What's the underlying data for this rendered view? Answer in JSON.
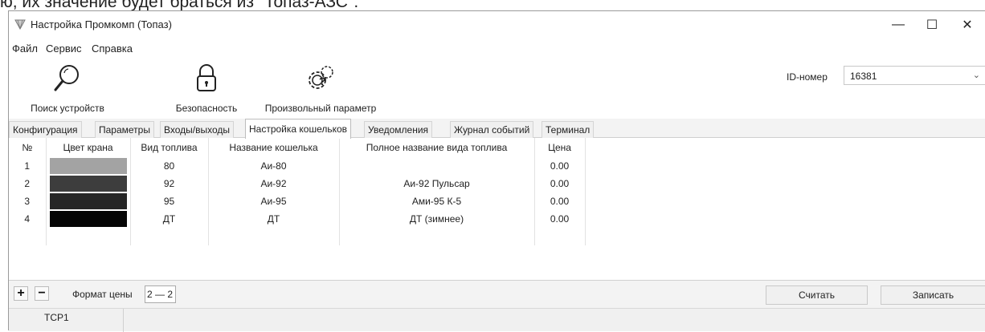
{
  "doc_line": "ю, их значение будет браться из \"Топаз-АЗС\".",
  "window": {
    "title": "Настройка Промкомп (Топаз)",
    "controls": {
      "minimize": "—",
      "maximize": "☐",
      "close": "✕"
    }
  },
  "menu": [
    "Файл",
    "Сервис",
    "Справка"
  ],
  "toolbar": {
    "tools": [
      {
        "label": "Поиск устройств",
        "icon": "magnifier-icon"
      },
      {
        "label": "Безопасность",
        "icon": "padlock-icon"
      },
      {
        "label": "Произвольный параметр",
        "icon": "gears-question-icon"
      }
    ],
    "id_label": "ID-номер",
    "id_value": "16381"
  },
  "tabs": [
    {
      "label": "Конфигурация",
      "active": false
    },
    {
      "label": "Параметры",
      "active": false
    },
    {
      "label": "Входы/выходы",
      "active": false
    },
    {
      "label": "Настройка кошельков",
      "active": true
    },
    {
      "label": "Уведомления",
      "active": false
    },
    {
      "label": "Журнал событий",
      "active": false
    },
    {
      "label": "Терминал",
      "active": false
    }
  ],
  "table": {
    "headers": [
      "№",
      "Цвет крана",
      "Вид топлива",
      "Название кошелька",
      "Полное название вида топлива",
      "Цена"
    ],
    "rows": [
      {
        "num": "1",
        "color": "#a3a3a3",
        "fuel": "80",
        "wallet": "Аи-80",
        "full_name": "",
        "price": "0.00"
      },
      {
        "num": "2",
        "color": "#3d3d3d",
        "fuel": "92",
        "wallet": "Аи-92",
        "full_name": "Аи-92 Пульсар",
        "price": "0.00"
      },
      {
        "num": "3",
        "color": "#262626",
        "fuel": "95",
        "wallet": "Аи-95",
        "full_name": "Ами-95 К-5",
        "price": "0.00"
      },
      {
        "num": "4",
        "color": "#050505",
        "fuel": "ДТ",
        "wallet": "ДТ",
        "full_name": "ДТ (зимнее)",
        "price": "0.00"
      }
    ]
  },
  "bottom": {
    "add": "+",
    "remove": "−",
    "price_format_label": "Формат цены",
    "price_format_value": "2 — 2",
    "read_button": "Считать",
    "write_button": "Записать"
  },
  "status": {
    "port": "TCP1"
  }
}
